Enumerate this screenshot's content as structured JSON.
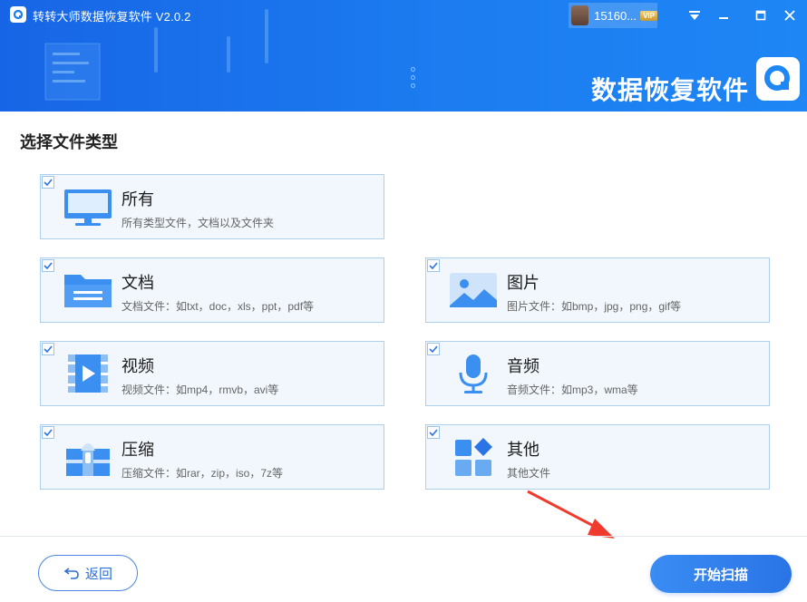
{
  "window": {
    "title": "转转大师数据恢复软件 V2.0.2",
    "user_name": "15160...",
    "vip_badge": "VIP",
    "brand_text": "数据恢复软件",
    "controls": [
      "menu-icon",
      "minimize-icon",
      "maximize-icon",
      "close-icon"
    ]
  },
  "main": {
    "section_title": "选择文件类型",
    "categories": [
      {
        "id": "all",
        "title": "所有",
        "desc": "所有类型文件，文档以及文件夹",
        "checked": true,
        "icon": "monitor-icon"
      },
      {
        "id": "document",
        "title": "文档",
        "desc": "文档文件：如txt，doc，xls，ppt，pdf等",
        "checked": true,
        "icon": "folder-icon"
      },
      {
        "id": "image",
        "title": "图片",
        "desc": "图片文件：如bmp，jpg，png，gif等",
        "checked": true,
        "icon": "image-icon"
      },
      {
        "id": "video",
        "title": "视频",
        "desc": "视频文件：如mp4，rmvb，avi等",
        "checked": true,
        "icon": "video-icon"
      },
      {
        "id": "audio",
        "title": "音频",
        "desc": "音频文件：如mp3，wma等",
        "checked": true,
        "icon": "microphone-icon"
      },
      {
        "id": "archive",
        "title": "压缩",
        "desc": "压缩文件：如rar，zip，iso，7z等",
        "checked": true,
        "icon": "archive-icon"
      },
      {
        "id": "other",
        "title": "其他",
        "desc": "其他文件",
        "checked": true,
        "icon": "apps-icon"
      }
    ]
  },
  "footer": {
    "back_label": "返回",
    "scan_label": "开始扫描"
  },
  "colors": {
    "header": "#1c7cf0",
    "accent": "#2a74e6",
    "card_bg": "#f1f7fd",
    "card_border": "#aed0ef",
    "annotation_arrow": "#f03a2e"
  }
}
